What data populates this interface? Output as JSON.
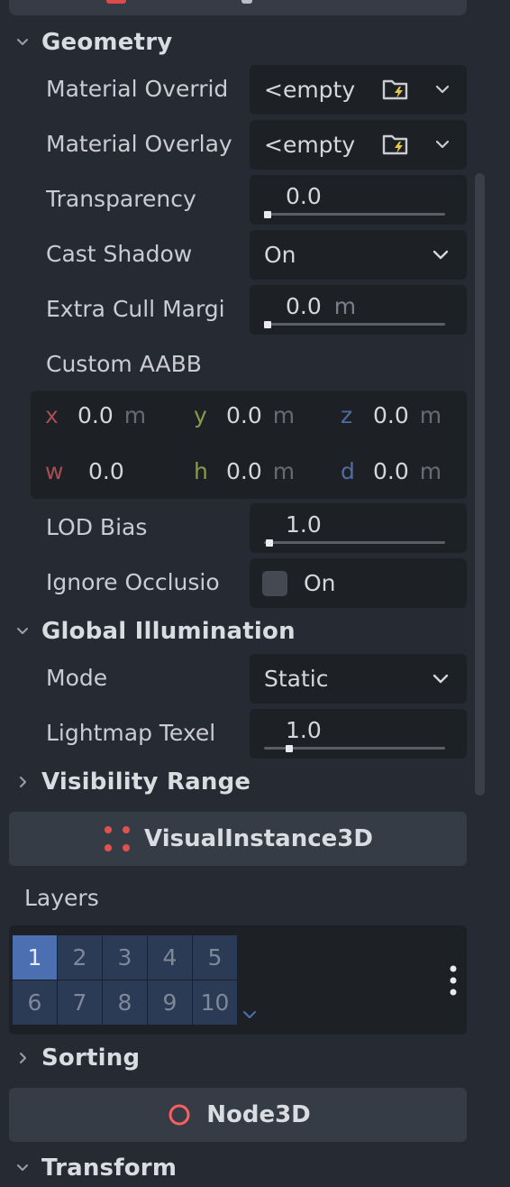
{
  "geometry": {
    "title": "Geometry",
    "material_override": {
      "label": "Material Overrid",
      "value": "<empty"
    },
    "material_overlay": {
      "label": "Material Overlay",
      "value": "<empty"
    },
    "transparency": {
      "label": "Transparency",
      "value": "0.0",
      "slider": 0
    },
    "cast_shadow": {
      "label": "Cast Shadow",
      "value": "On"
    },
    "extra_cull_margin": {
      "label": "Extra Cull Margi",
      "value": "0.0",
      "unit": "m",
      "slider": 0
    },
    "custom_aabb": {
      "label": "Custom AABB",
      "x": {
        "axis": "x",
        "value": "0.0",
        "unit": "m"
      },
      "y": {
        "axis": "y",
        "value": "0.0",
        "unit": "m"
      },
      "z": {
        "axis": "z",
        "value": "0.0",
        "unit": "m"
      },
      "w": {
        "axis": "w",
        "value": "0.0"
      },
      "h": {
        "axis": "h",
        "value": "0.0",
        "unit": "m"
      },
      "d": {
        "axis": "d",
        "value": "0.0",
        "unit": "m"
      }
    },
    "lod_bias": {
      "label": "LOD Bias",
      "value": "1.0",
      "slider": 0.01
    },
    "ignore_occlusion": {
      "label": "Ignore Occlusio",
      "value": "On",
      "checked": false
    }
  },
  "global_illumination": {
    "title": "Global Illumination",
    "mode": {
      "label": "Mode",
      "value": "Static"
    },
    "lightmap_texel": {
      "label": "Lightmap Texel",
      "value": "1.0",
      "slider": 0.12
    }
  },
  "visibility_range": {
    "title": "Visibility Range"
  },
  "visual_instance": {
    "label": "VisualInstance3D",
    "accent": "#e05252"
  },
  "layers": {
    "label": "Layers",
    "cells": [
      {
        "n": "1",
        "on": true
      },
      {
        "n": "2",
        "on": false
      },
      {
        "n": "3",
        "on": false
      },
      {
        "n": "4",
        "on": false
      },
      {
        "n": "5",
        "on": false
      },
      {
        "n": "6",
        "on": false
      },
      {
        "n": "7",
        "on": false
      },
      {
        "n": "8",
        "on": false
      },
      {
        "n": "9",
        "on": false
      },
      {
        "n": "10",
        "on": false
      }
    ]
  },
  "sorting": {
    "title": "Sorting"
  },
  "node3d": {
    "label": "Node3D",
    "accent": "#fc5f5f"
  },
  "transform": {
    "title": "Transform"
  },
  "icons": {
    "section": "chevron-down-icon",
    "collapsed": "chevron-right-icon",
    "resource": "folder-quick-load-icon",
    "visual_instance": "visual-instance-3d-icon",
    "node3d": "node-3d-icon"
  }
}
